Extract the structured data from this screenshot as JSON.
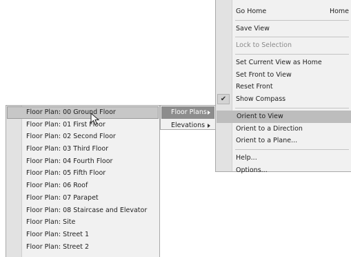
{
  "main_menu": {
    "items": [
      {
        "label": "Go Home",
        "shortcut": "Home"
      },
      {
        "label": "Save View"
      },
      {
        "label": "Lock to Selection",
        "disabled": true
      },
      {
        "label": "Set Current View as Home"
      },
      {
        "label": "Set Front to View"
      },
      {
        "label": "Reset Front"
      },
      {
        "label": "Show Compass",
        "checked": true,
        "check_glyph": "✔"
      },
      {
        "label": "Orient to View",
        "highlighted": true
      },
      {
        "label": "Orient to a Direction"
      },
      {
        "label": "Orient to a Plane..."
      },
      {
        "label": "Help..."
      },
      {
        "label": "Options..."
      }
    ]
  },
  "sub_menu": {
    "items": [
      {
        "label": "Floor Plans",
        "highlighted": true
      },
      {
        "label": "Elevations"
      }
    ]
  },
  "plan_menu": {
    "items": [
      {
        "label": "Floor Plan: 00 Ground Floor",
        "highlighted": true
      },
      {
        "label": "Floor Plan: 01 First Floor"
      },
      {
        "label": "Floor Plan: 02 Second Floor"
      },
      {
        "label": "Floor Plan: 03 Third Floor"
      },
      {
        "label": "Floor Plan: 04 Fourth Floor"
      },
      {
        "label": "Floor Plan: 05 Fifth Floor"
      },
      {
        "label": "Floor Plan: 06 Roof"
      },
      {
        "label": "Floor Plan: 07 Parapet"
      },
      {
        "label": "Floor Plan: 08 Staircase and Elevator"
      },
      {
        "label": "Floor Plan: Site"
      },
      {
        "label": "Floor Plan: Street 1"
      },
      {
        "label": "Floor Plan: Street 2"
      }
    ]
  },
  "colors": {
    "menu_bg": "#f1f1f1",
    "gutter_bg": "#e2e2e2",
    "highlight_bg": "#bdbdbd",
    "submenu_highlight_bg": "#8d8d8d",
    "disabled_text": "#8a8a8a"
  }
}
